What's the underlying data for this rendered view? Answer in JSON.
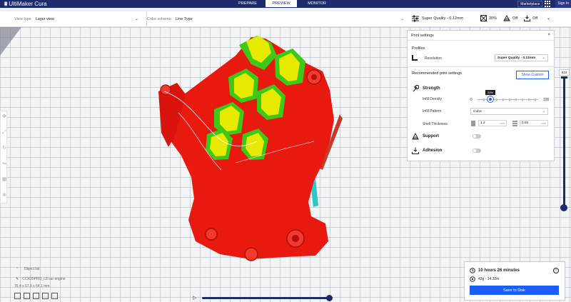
{
  "app": {
    "title": "UltiMaker Cura"
  },
  "topbar": {
    "tabs": [
      {
        "label": "PREPARE"
      },
      {
        "label": "PREVIEW"
      },
      {
        "label": "MONITOR"
      }
    ],
    "marketplace_label": "Marketplace",
    "signin_label": "Sign In"
  },
  "view_bar": {
    "view_type": {
      "label": "View type",
      "value": "Layer view"
    },
    "color_scheme": {
      "label": "Color scheme",
      "value": "Line Type"
    }
  },
  "quality_bar": {
    "profile": "Super Quality - 0.12mm",
    "infill": "20%",
    "support": "Off",
    "adhesion": "Off"
  },
  "print_settings": {
    "title": "Print settings",
    "profiles_label": "Profiles",
    "resolution_label": "Resolution",
    "resolution_value": "Super Quality - 0.12mm",
    "recommended_label": "Recommended print settings",
    "show_custom_label": "Show Custom",
    "strength_label": "Strength",
    "infill_density_label": "Infill Density",
    "infill_min": "0",
    "infill_max": "100",
    "infill_value": "20%",
    "infill_pattern_label": "Infill Pattern",
    "infill_pattern_value": "Cubic",
    "shell_thickness_label": "Shell Thickness",
    "wall_value": "1.2",
    "top_bottom_value": "0.84",
    "unit": "mm",
    "support_label": "Support",
    "adhesion_label": "Adhesion"
  },
  "layer_slider": {
    "value": "534"
  },
  "object_list": {
    "header": "Object list",
    "object_name": "CCR30PRO_L8 car engine",
    "dimensions": "76.4 x 57.3 x 64.1 mm"
  },
  "estimate": {
    "time": "10 hours 26 minutes",
    "material": "43g · 14.32m",
    "save_label": "Save to Disk"
  },
  "colors": {
    "brand_dark": "#1b2b6b",
    "accent": "#1b5ef7",
    "model_red": "#e8190f",
    "model_yellow": "#e6e900",
    "model_green": "#3ec81a",
    "support_cyan": "#2ec7c7"
  }
}
